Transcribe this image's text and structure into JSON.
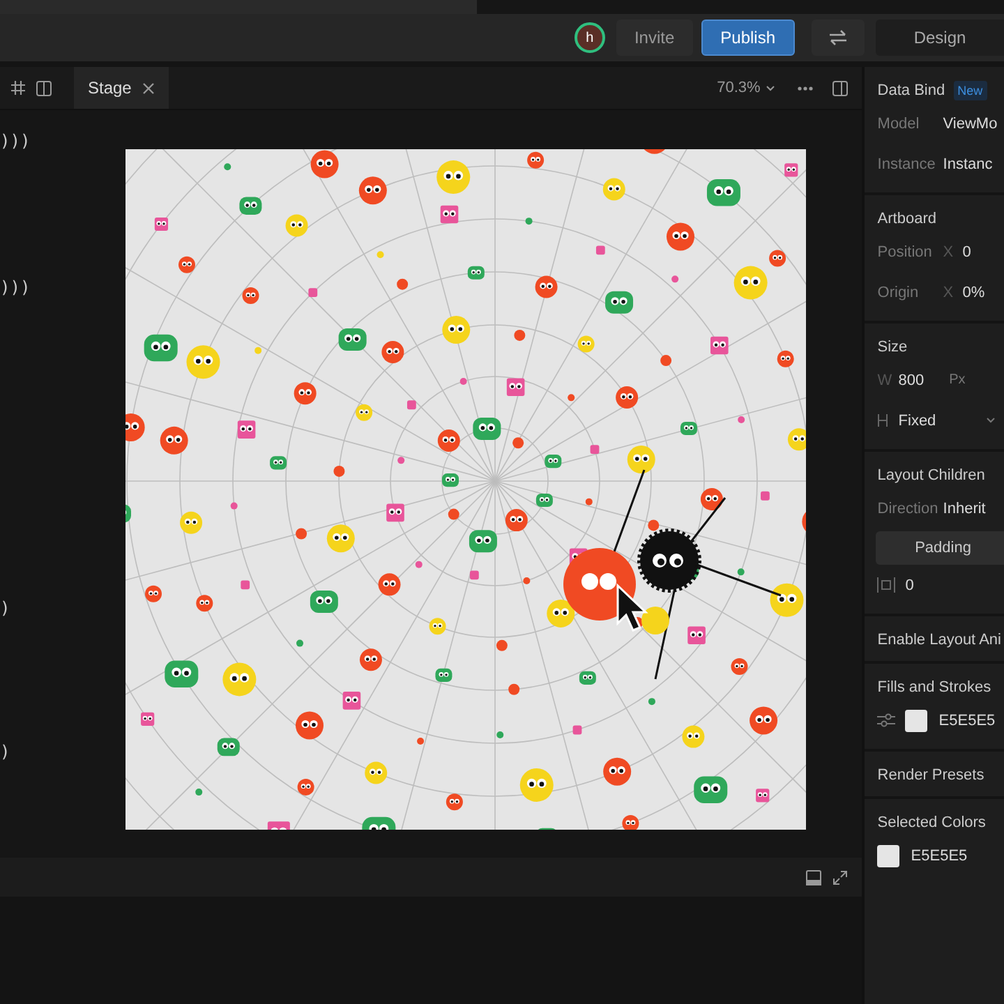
{
  "header": {
    "avatar_initial": "h",
    "buttons": [
      {
        "label": "Invite",
        "kind": "plain"
      },
      {
        "label": "Publish",
        "kind": "primary"
      }
    ],
    "mode_tab": "Design"
  },
  "tabs": [
    {
      "label": "Stage",
      "selected": true
    }
  ],
  "zoom": "70.3%",
  "code_fragments": [
    ")))",
    ")))",
    ")",
    ")"
  ],
  "inspector": [
    {
      "title": "Data Bind",
      "badge": "New",
      "rows": [
        {
          "kind": "field",
          "label": "Model",
          "value": "ViewMo"
        },
        {
          "kind": "field",
          "label": "Instance",
          "value": "Instanc"
        }
      ]
    },
    {
      "title": "Artboard",
      "rows": [
        {
          "kind": "axis",
          "label": "Position",
          "axis": "X",
          "value": "0"
        },
        {
          "kind": "axis",
          "label": "Origin",
          "axis": "X",
          "value": "0%"
        }
      ]
    },
    {
      "title": "Size",
      "rows": [
        {
          "kind": "dimension",
          "axis": "W",
          "value": "800",
          "unit": "Px"
        },
        {
          "kind": "select",
          "value": "Fixed"
        }
      ]
    },
    {
      "title": "Layout Children",
      "rows": [
        {
          "kind": "field",
          "label": "Direction",
          "value": "Inherit"
        },
        {
          "kind": "button",
          "label": "Padding"
        },
        {
          "kind": "padding",
          "value": "0"
        }
      ]
    },
    {
      "title": "Enable Layout Ani"
    },
    {
      "title": "Fills and Strokes",
      "rows": [
        {
          "kind": "fill",
          "value": "E5E5E5"
        }
      ]
    },
    {
      "title": "Render Presets"
    },
    {
      "title": "Selected Colors",
      "rows": [
        {
          "kind": "color",
          "value": "E5E5E5"
        }
      ]
    }
  ]
}
